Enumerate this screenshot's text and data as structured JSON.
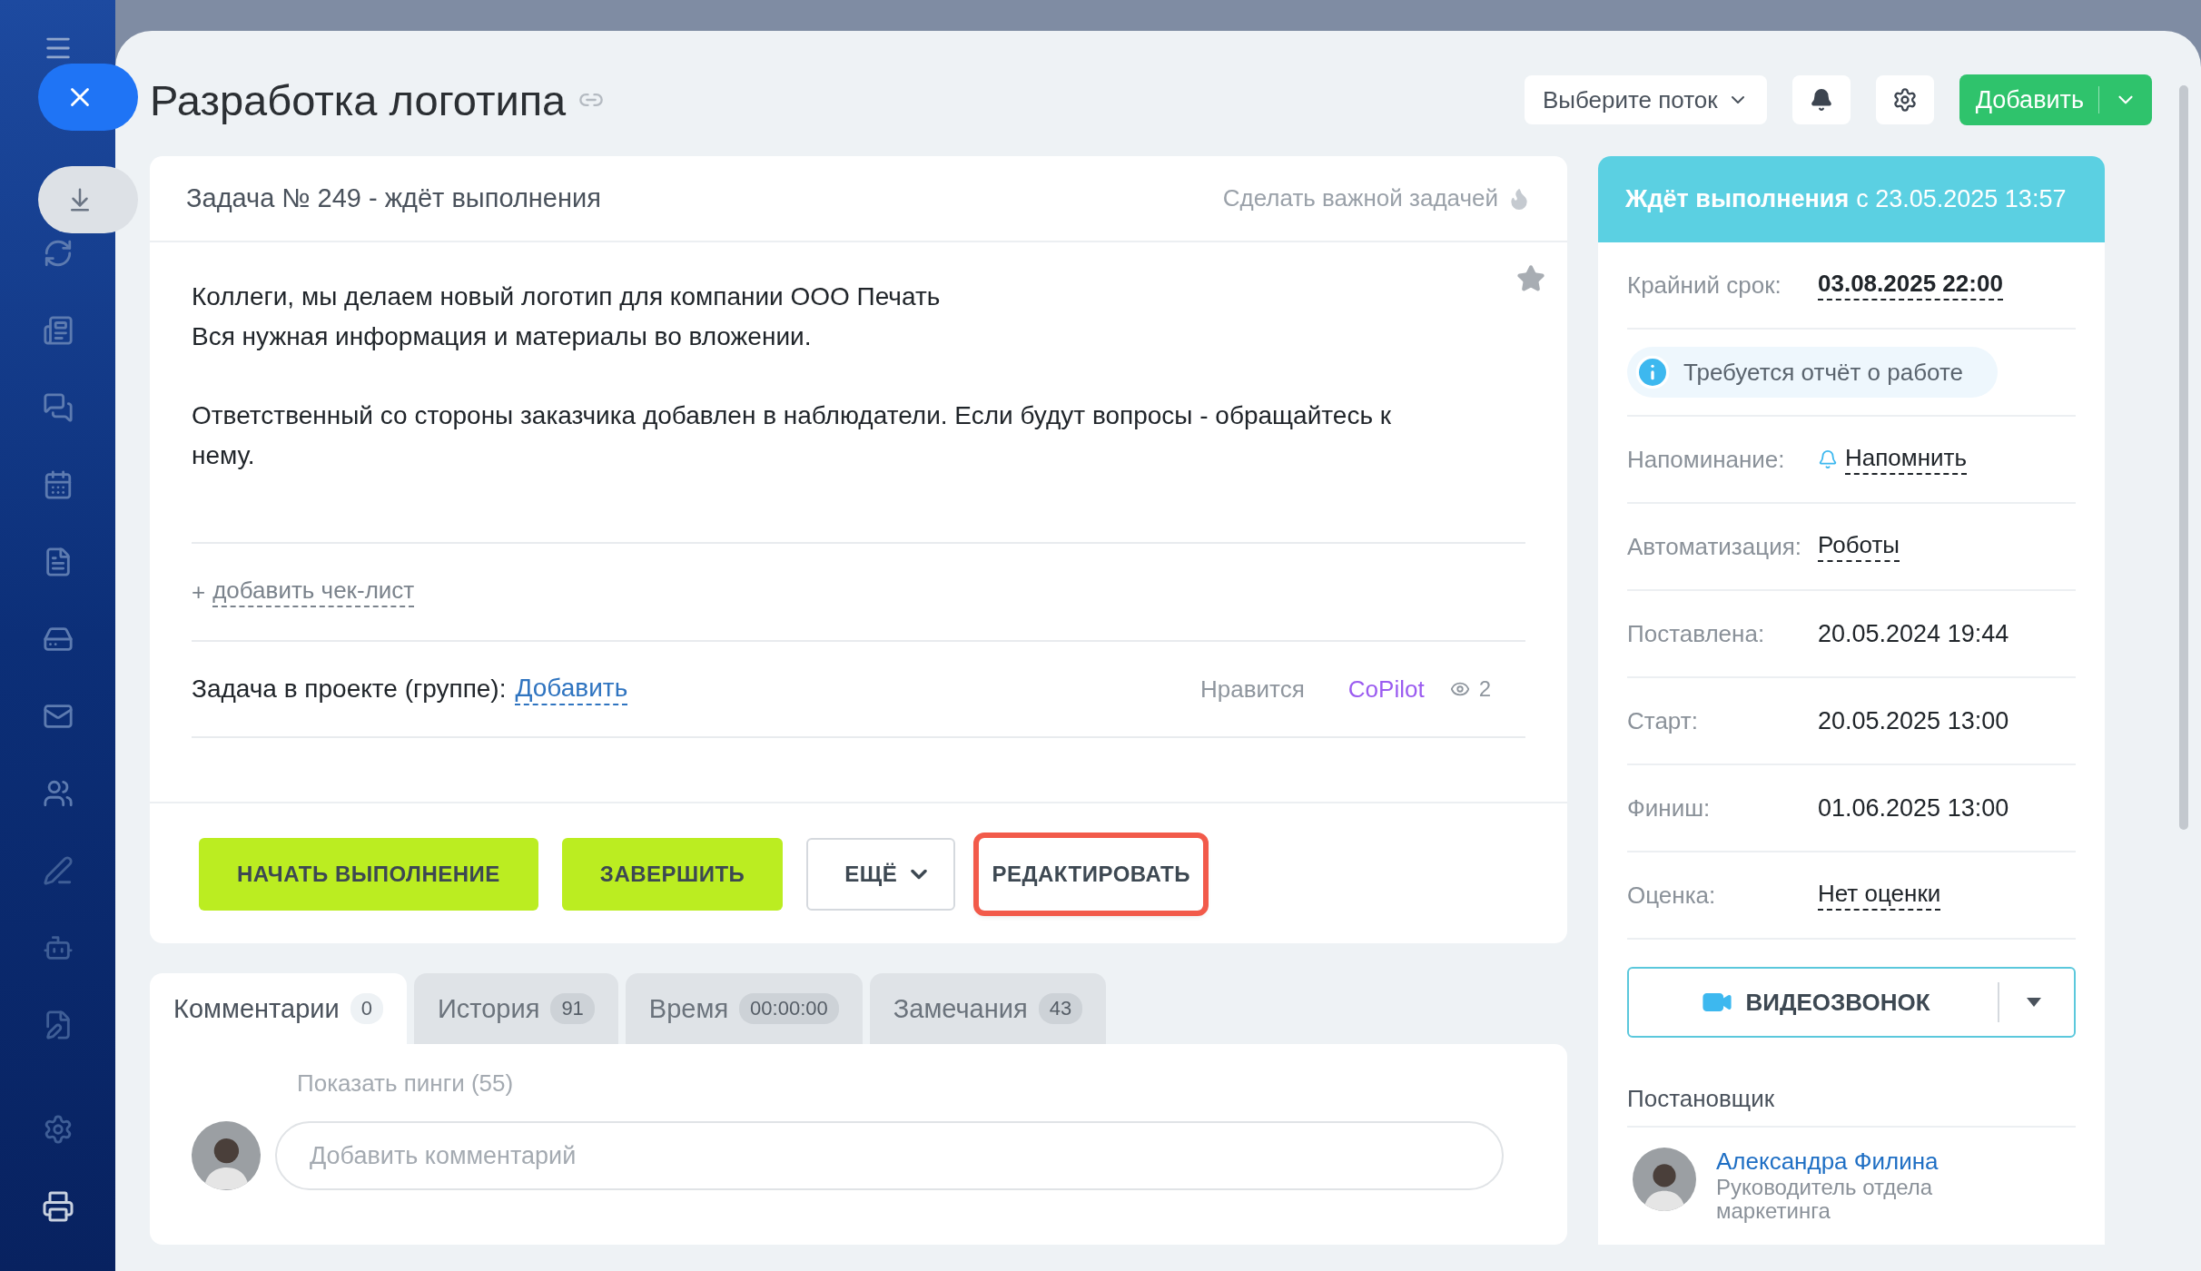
{
  "title": "Разработка логотипа",
  "header": {
    "flow_select": "Выберите поток",
    "add_button": "Добавить"
  },
  "task": {
    "heading": "Задача № 249 - ждёт выполнения",
    "important_link": "Сделать важной задачей",
    "starred": false,
    "paragraphs": [
      [
        "Коллеги, мы делаем новый логотип для компании ООО Печать",
        "Вся нужная информация и материалы во вложении."
      ],
      [
        "Ответственный со стороны заказчика добавлен в наблюдатели. Если будут вопросы - обращайтесь к нему."
      ]
    ],
    "checklist_prefix": "+",
    "checklist_link": "добавить чек-лист",
    "project_label": "Задача в проекте (группе):",
    "project_link": "Добавить",
    "like": "Нравится",
    "copilot": "CoPilot",
    "views": "2"
  },
  "actions": [
    {
      "kind": "primary",
      "label": "НАЧАТЬ ВЫПОЛНЕНИЕ",
      "highlighted": false
    },
    {
      "kind": "primary",
      "label": "ЗАВЕРШИТЬ",
      "highlighted": false
    },
    {
      "kind": "dropdown",
      "label": "ЕЩЁ",
      "highlighted": false
    },
    {
      "kind": "plain",
      "label": "РЕДАКТИРОВАТЬ",
      "highlighted": true
    }
  ],
  "tabs": [
    {
      "label": "Комментарии",
      "count": "0",
      "selected": true
    },
    {
      "label": "История",
      "count": "91",
      "selected": false
    },
    {
      "label": "Время",
      "count": "00:00:00",
      "selected": false
    },
    {
      "label": "Замечания",
      "count": "43",
      "selected": false
    }
  ],
  "comments": {
    "show_pings": "Показать пинги (55)",
    "placeholder": "Добавить комментарий"
  },
  "side": {
    "status": "Ждёт выполнения",
    "status_since": "с 23.05.2025 13:57",
    "rows": [
      {
        "kind": "strong",
        "label": "Крайний срок:",
        "value": "03.08.2025 22:00"
      },
      {
        "kind": "notice",
        "value": "Требуется отчёт о работе"
      },
      {
        "kind": "bell_link",
        "label": "Напоминание:",
        "value": "Напомнить"
      },
      {
        "kind": "link",
        "label": "Автоматизация:",
        "value": "Роботы"
      },
      {
        "kind": "plain",
        "label": "Поставлена:",
        "value": "20.05.2024 19:44"
      },
      {
        "kind": "plain",
        "label": "Старт:",
        "value": "20.05.2025 13:00"
      },
      {
        "kind": "plain",
        "label": "Финиш:",
        "value": "01.06.2025 13:00"
      },
      {
        "kind": "link",
        "label": "Оценка:",
        "value": "Нет оценки"
      }
    ],
    "video_button": "ВИДЕОЗВОНОК",
    "creator_heading": "Постановщик",
    "creator_name": "Александра Филина",
    "creator_role": "Руководитель отдела маркетинга"
  }
}
